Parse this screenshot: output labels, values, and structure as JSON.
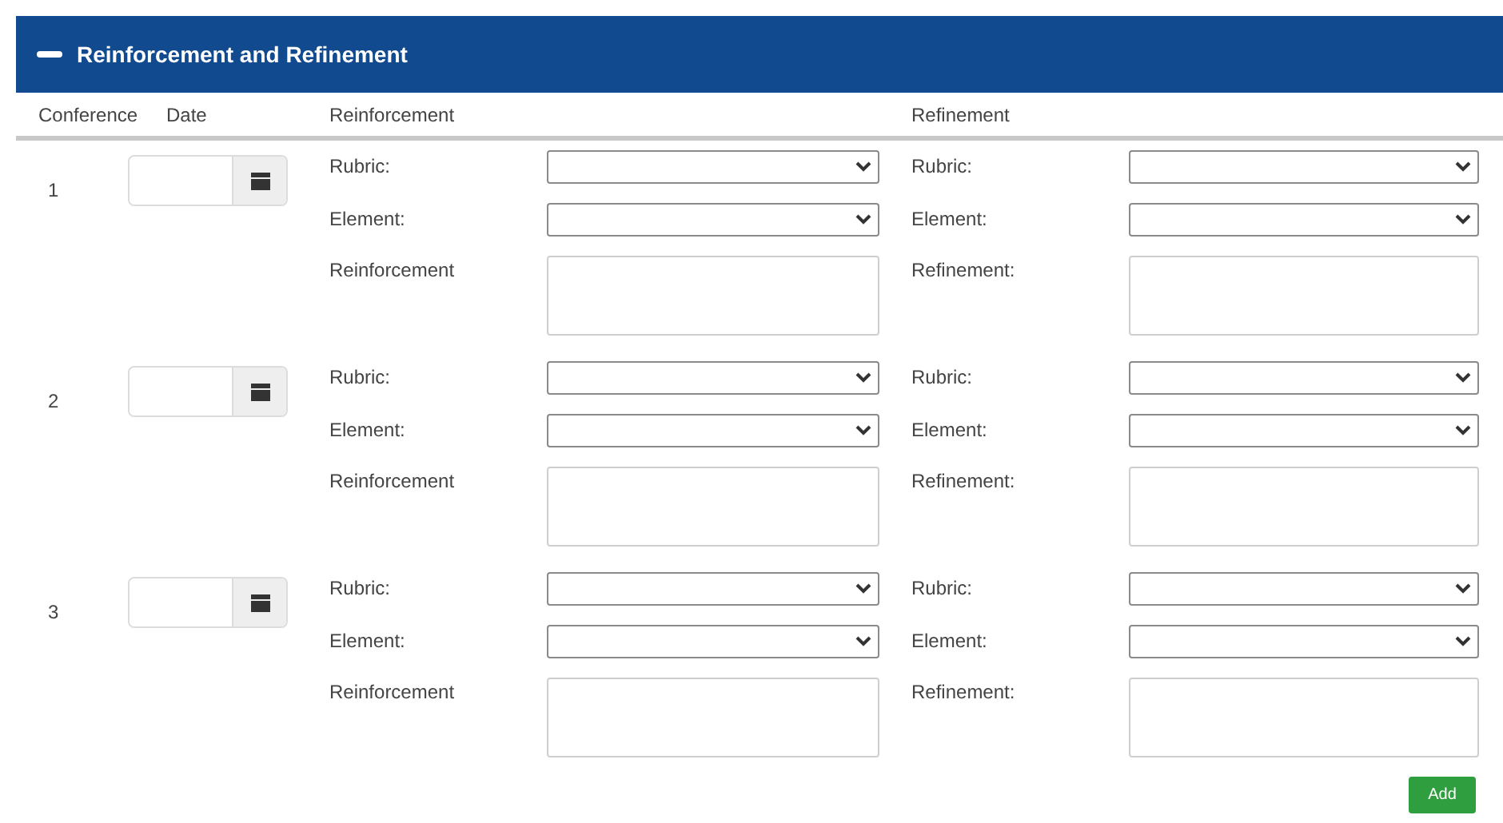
{
  "panel": {
    "title": "Reinforcement and Refinement",
    "expanded": true
  },
  "columns": [
    "Conference",
    "Date",
    "Reinforcement",
    "Refinement"
  ],
  "conferences": [
    {
      "number": "1",
      "reinforcement": {
        "rubric_label": "Rubric:",
        "element_label": "Element:",
        "text_label": "Reinforcement"
      },
      "refinement": {
        "rubric_label": "Rubric:",
        "element_label": "Element:",
        "text_label": "Refinement:"
      }
    },
    {
      "number": "2",
      "reinforcement": {
        "rubric_label": "Rubric:",
        "element_label": "Element:",
        "text_label": "Reinforcement"
      },
      "refinement": {
        "rubric_label": "Rubric:",
        "element_label": "Element:",
        "text_label": "Refinement:"
      }
    },
    {
      "number": "3",
      "reinforcement": {
        "rubric_label": "Rubric:",
        "element_label": "Element:",
        "text_label": "Reinforcement"
      },
      "refinement": {
        "rubric_label": "Rubric:",
        "element_label": "Element:",
        "text_label": "Refinement:"
      }
    }
  ],
  "add_button": "Add"
}
